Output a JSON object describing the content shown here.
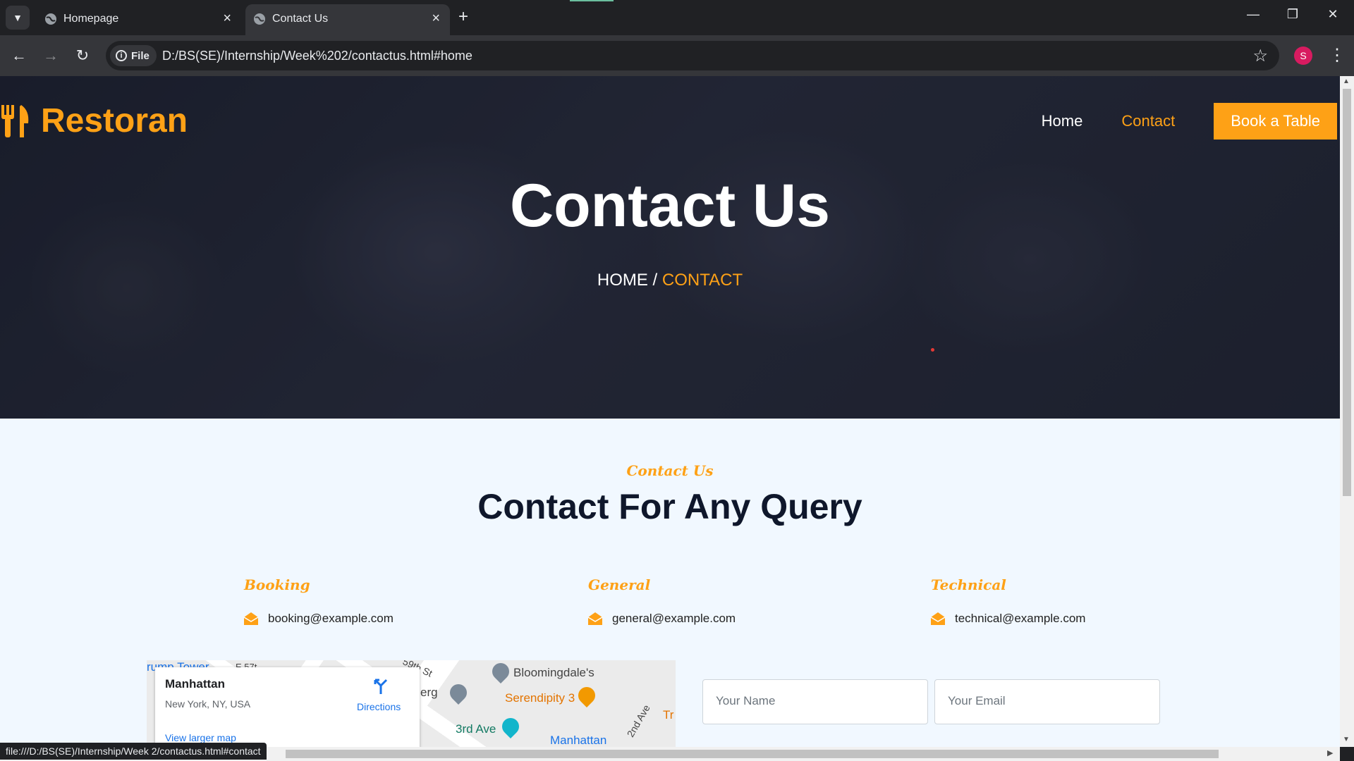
{
  "browser": {
    "tabs": [
      {
        "title": "Homepage",
        "active": false
      },
      {
        "title": "Contact Us",
        "active": true
      }
    ],
    "address": {
      "scheme_chip": "File",
      "url": "D:/BS(SE)/Internship/Week%202/contactus.html#home"
    },
    "profile_initial": "S",
    "status_url": "file:///D:/BS(SE)/Internship/Week 2/contactus.html#contact"
  },
  "site": {
    "brand": "Restoran",
    "brand_color": "#fea116",
    "nav": {
      "home": "Home",
      "contact": "Contact",
      "book": "Book a Table"
    },
    "hero": {
      "title": "Contact Us",
      "breadcrumb_home": "HOME",
      "breadcrumb_sep": "/",
      "breadcrumb_current": "CONTACT"
    },
    "section": {
      "tag": "Contact Us",
      "title": "Contact For Any Query"
    },
    "contacts": [
      {
        "label": "Booking",
        "email": "booking@example.com"
      },
      {
        "label": "General",
        "email": "general@example.com"
      },
      {
        "label": "Technical",
        "email": "technical@example.com"
      }
    ],
    "map": {
      "place": "Manhattan",
      "address": "New York, NY, USA",
      "directions": "Directions",
      "larger_map": "View larger map",
      "labels": {
        "trump_tower": "rump Tower",
        "street_57": "E 57t",
        "street_59": "59th St",
        "bloomingdales": "Bloomingdale's",
        "serendipity": "Serendipity 3",
        "berg": "erg",
        "third_ave": "3rd Ave",
        "second_ave": "2nd Ave",
        "manhattan": "Manhattan",
        "tr": "Tr"
      }
    },
    "form": {
      "name_placeholder": "Your Name",
      "email_placeholder": "Your Email"
    }
  }
}
